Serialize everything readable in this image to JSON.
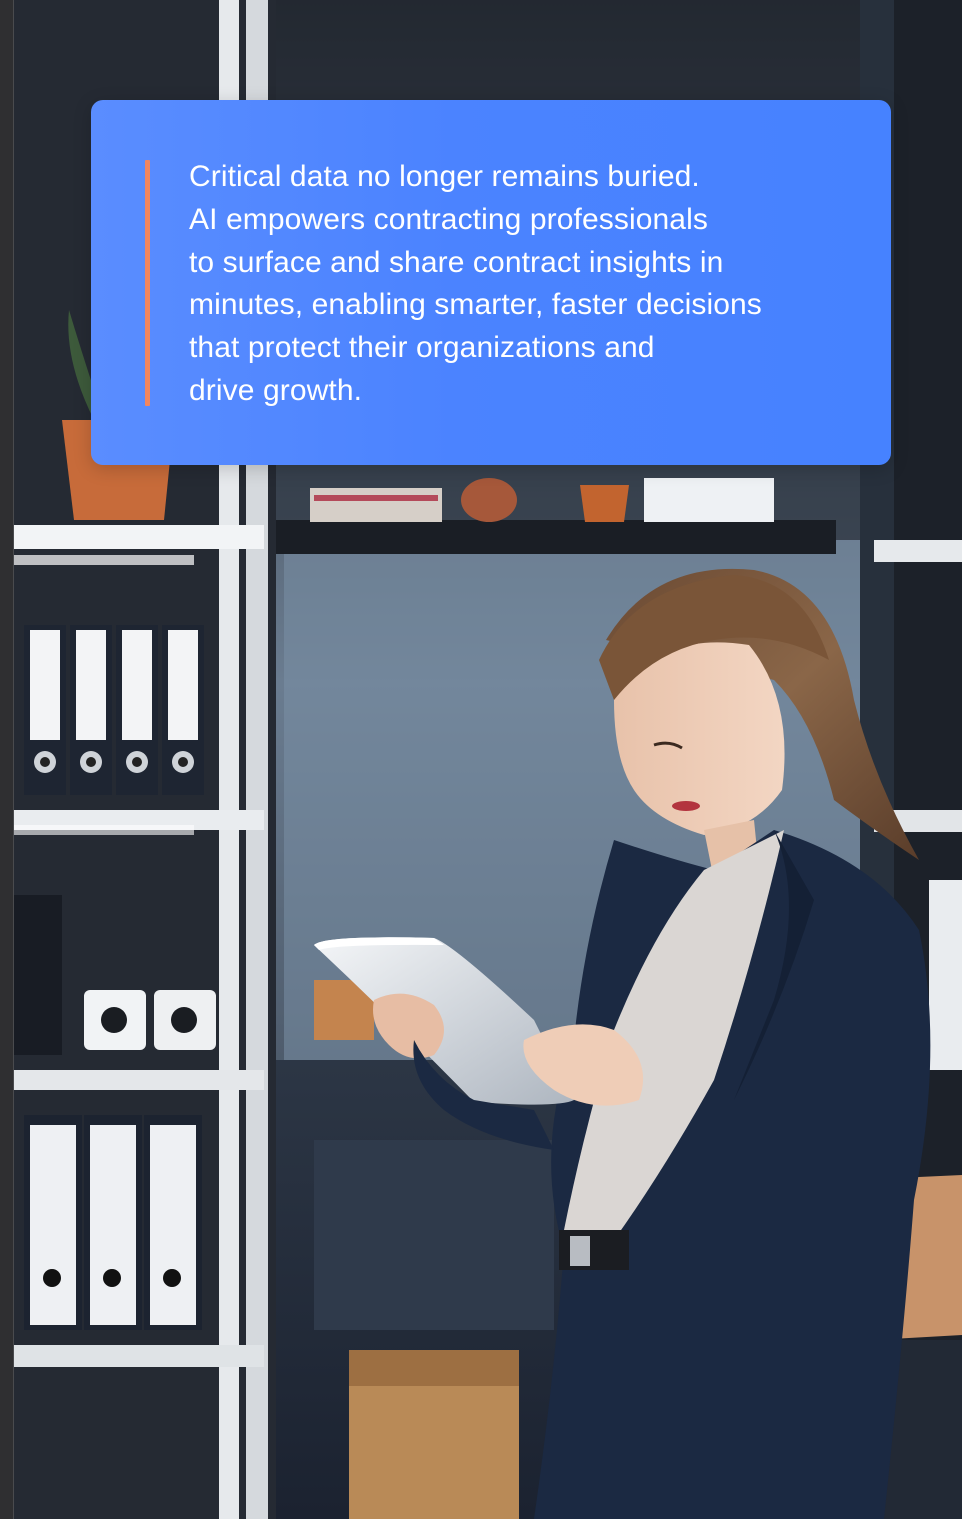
{
  "quote": {
    "lines": [
      "Critical data no longer remains buried.",
      "AI empowers contracting professionals",
      "to surface and share contract insights in",
      "minutes, enabling smarter, faster decisions",
      "that protect their organizations and",
      "drive growth."
    ],
    "accent_color": "#f2865f",
    "card_color": "#4b83ff"
  },
  "photo": {
    "subject": "woman-using-tablet-in-office"
  }
}
